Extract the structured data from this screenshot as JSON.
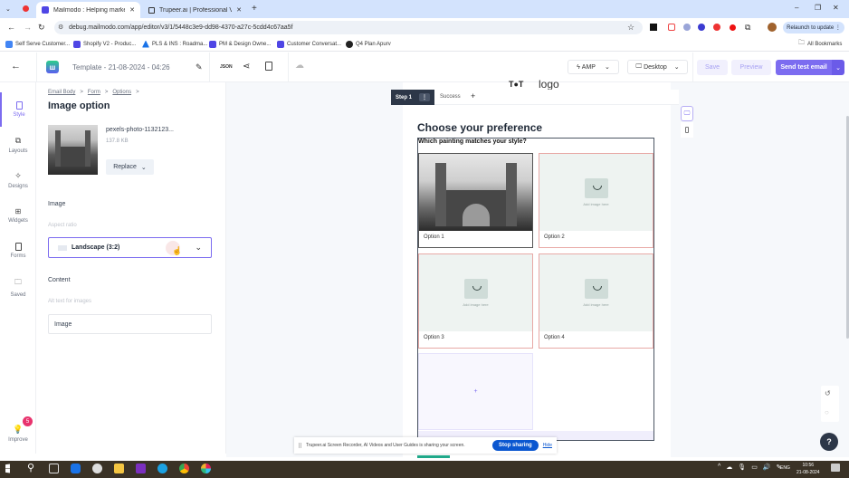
{
  "browser": {
    "tabs": [
      {
        "label": "Mailmodo : Helping marketers",
        "active": true
      },
      {
        "label": "Trupeer.ai | Professional Videos",
        "active": false
      }
    ],
    "url": "debug.mailmodo.com/app/editor/v3/1/5448c3e9-dd98-4370-a27c-5cdd4c67aa5f",
    "relaunch_label": "Relaunch to update",
    "bookmarks": [
      "Self Serve Customer...",
      "Shopify V2 - Produc...",
      "PLS & INS : Roadma...",
      "PM & Design Owne...",
      "Customer Conversat...",
      "Q4 Plan Apurv"
    ],
    "all_bookmarks_label": "All Bookmarks"
  },
  "header": {
    "template_name": "Template - 21-08-2024 - 04:26",
    "json_label": "JSON",
    "amp_label": "AMP",
    "view_label": "Desktop",
    "save_label": "Save",
    "preview_label": "Preview",
    "send_test_label": "Send test email"
  },
  "rail": {
    "items": [
      {
        "label": "Style",
        "active": true
      },
      {
        "label": "Layouts"
      },
      {
        "label": "Designs"
      },
      {
        "label": "Widgets"
      },
      {
        "label": "Forms"
      },
      {
        "label": "Saved"
      }
    ],
    "improve_label": "Improve",
    "improve_badge": "5"
  },
  "panel": {
    "breadcrumb": [
      "Email Body",
      "Form",
      "Options"
    ],
    "title": "Image option",
    "file_name": "pexels-photo-1132123...",
    "file_size": "137.8 KB",
    "replace_label": "Replace",
    "image_section": "Image",
    "aspect_ratio_label": "Aspect ratio",
    "aspect_ratio_value": "Landscape (3:2)",
    "content_section": "Content",
    "alt_text_label": "Alt text for images",
    "alt_text_value": "Image"
  },
  "canvas": {
    "logo_text": "logo",
    "steps": [
      "Step 1",
      "Success"
    ],
    "form_title": "Choose your preference",
    "question": "Which painting matches your style?",
    "options": [
      "Option 1",
      "Option 2",
      "Option 3",
      "Option 4"
    ],
    "placeholder_text": "Add image here",
    "add_option_symbol": "+"
  },
  "share_bar": {
    "message": "Trupeer.ai Screen Recorder, AI Videos and User Guides is sharing your screen.",
    "stop_label": "Stop sharing",
    "hide_label": "Hide"
  },
  "help_symbol": "?",
  "taskbar": {
    "language": "ENG",
    "time": "10:56",
    "date": "21-08-2024"
  },
  "colors": {
    "accent": "#7c6cf0",
    "primary_button": "#7c6cf0",
    "step_active_bg": "#2d3748",
    "badge": "#e8336d",
    "stop_sharing": "#0b57d0"
  }
}
